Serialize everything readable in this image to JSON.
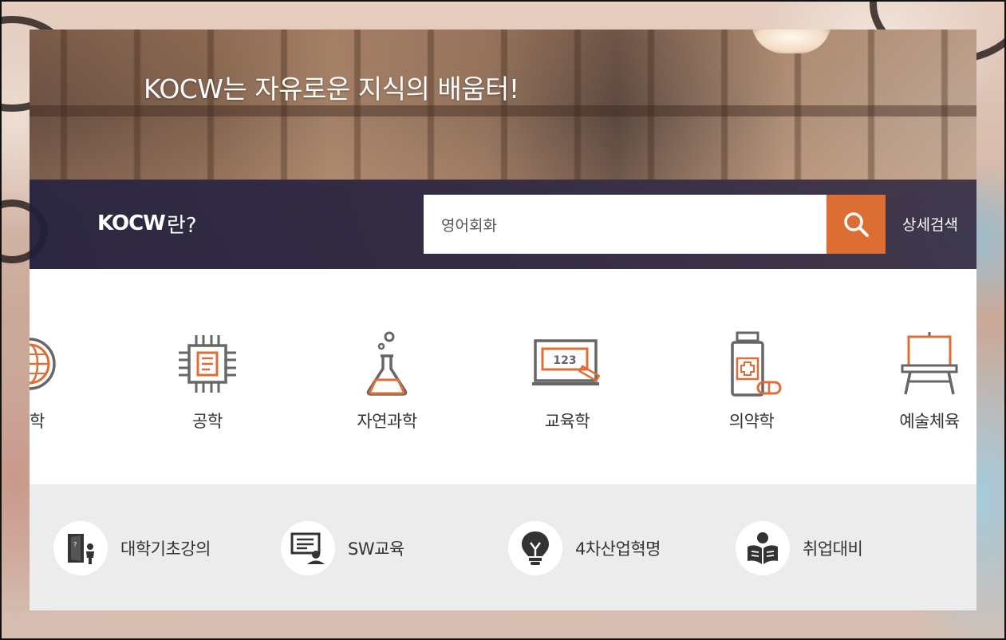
{
  "hero": {
    "title": "KOCW는 자유로운 지식의 배움터!"
  },
  "search": {
    "logo_mark": "KOCW",
    "logo_suffix": "란?",
    "query": "영어회화",
    "button_icon": "search-icon",
    "advanced_label": "상세검색",
    "accent_color": "#dc6e34"
  },
  "categories": [
    {
      "label": "과학",
      "icon": "globe-icon"
    },
    {
      "label": "공학",
      "icon": "chip-icon"
    },
    {
      "label": "자연과학",
      "icon": "flask-icon"
    },
    {
      "label": "교육학",
      "icon": "blackboard-icon"
    },
    {
      "label": "의약학",
      "icon": "medicine-bottle-icon"
    },
    {
      "label": "예술체육",
      "icon": "easel-icon"
    }
  ],
  "special": [
    {
      "label": "대학기초강의",
      "icon": "door-person-icon"
    },
    {
      "label": "SW교육",
      "icon": "monitor-person-icon"
    },
    {
      "label": "4차산업혁명",
      "icon": "lightbulb-icon"
    },
    {
      "label": "취업대비",
      "icon": "reading-person-icon"
    }
  ]
}
